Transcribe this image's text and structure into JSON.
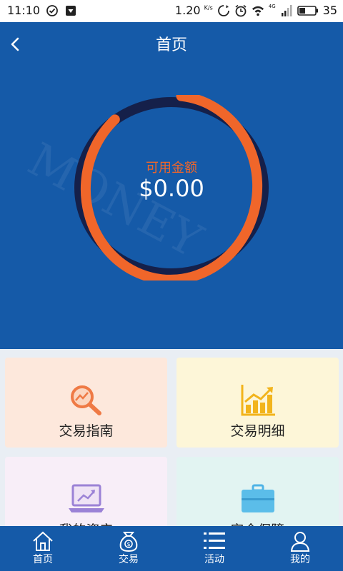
{
  "status_bar": {
    "time": "11:10",
    "speed": "1.20",
    "speed_unit": "K/s",
    "network": "4G",
    "battery": "35"
  },
  "header": {
    "title": "首页"
  },
  "balance": {
    "label": "可用金额",
    "value": "$0.00",
    "ring_fill_fraction": 0.87,
    "colors": {
      "accent": "#f0662a",
      "remainder": "#15204a",
      "background": "#155aa8"
    }
  },
  "cards": [
    {
      "label": "交易指南",
      "icon": "magnifier-chart-icon"
    },
    {
      "label": "交易明细",
      "icon": "bar-chart-icon"
    },
    {
      "label": "我的资产",
      "icon": "laptop-chart-icon"
    },
    {
      "label": "安全保障",
      "icon": "briefcase-icon"
    }
  ],
  "tabs": [
    {
      "label": "首页",
      "icon": "home-icon"
    },
    {
      "label": "交易",
      "icon": "money-bag-icon"
    },
    {
      "label": "活动",
      "icon": "list-icon"
    },
    {
      "label": "我的",
      "icon": "user-icon"
    }
  ]
}
